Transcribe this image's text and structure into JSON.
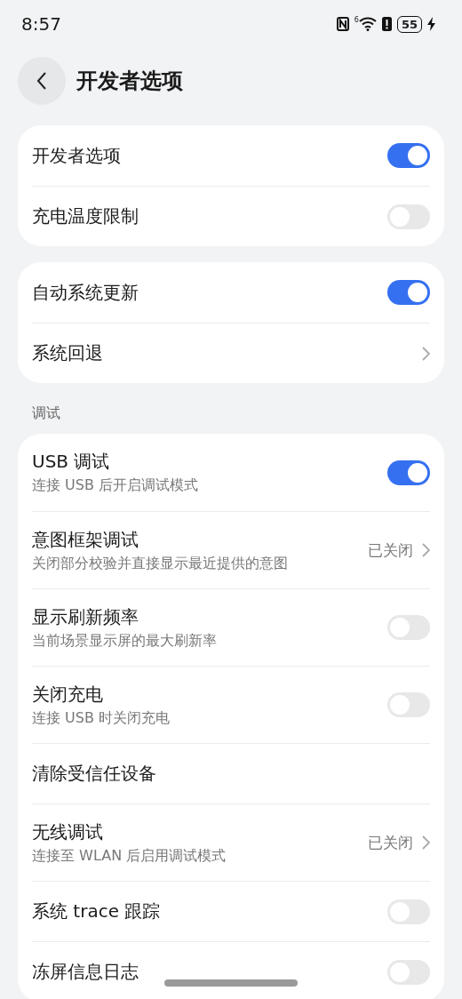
{
  "status_bar": {
    "time": "8:57",
    "signal_label": "6",
    "battery": "55"
  },
  "header": {
    "title": "开发者选项"
  },
  "groups": [
    {
      "rows": [
        {
          "kind": "toggle",
          "title": "开发者选项",
          "on": true
        },
        {
          "kind": "toggle",
          "title": "充电温度限制",
          "on": false
        }
      ]
    },
    {
      "rows": [
        {
          "kind": "toggle",
          "title": "自动系统更新",
          "on": true
        },
        {
          "kind": "link",
          "title": "系统回退"
        }
      ]
    },
    {
      "label": "调试",
      "rows": [
        {
          "kind": "toggle",
          "title": "USB 调试",
          "subtitle": "连接 USB 后开启调试模式",
          "on": true
        },
        {
          "kind": "link",
          "title": "意图框架调试",
          "subtitle": "关闭部分校验并直接显示最近提供的意图",
          "value": "已关闭"
        },
        {
          "kind": "toggle",
          "title": "显示刷新频率",
          "subtitle": "当前场景显示屏的最大刷新率",
          "on": false
        },
        {
          "kind": "toggle",
          "title": "关闭充电",
          "subtitle": "连接 USB 时关闭充电",
          "on": false
        },
        {
          "kind": "plain",
          "title": "清除受信任设备"
        },
        {
          "kind": "link",
          "title": "无线调试",
          "subtitle": "连接至 WLAN 后启用调试模式",
          "value": "已关闭"
        },
        {
          "kind": "toggle",
          "title": "系统 trace 跟踪",
          "on": false
        },
        {
          "kind": "toggle",
          "title": "冻屏信息日志",
          "on": false
        }
      ]
    }
  ]
}
